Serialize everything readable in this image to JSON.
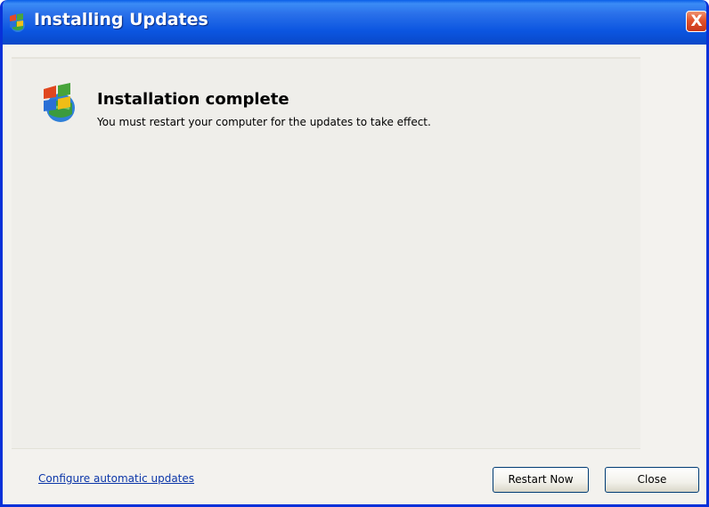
{
  "window": {
    "title": "Installing Updates",
    "close_glyph": "X",
    "title_icon": "windows-update-icon"
  },
  "content": {
    "icon": "windows-update-icon",
    "heading": "Installation complete",
    "message": "You must restart your computer for the updates to take effect."
  },
  "footer": {
    "link": "Configure automatic updates",
    "restart_button": "Restart Now",
    "close_button": "Close"
  },
  "colors": {
    "titlebar": "#0a5ee8",
    "link": "#0b36a8",
    "close_button": "#e2542d"
  }
}
